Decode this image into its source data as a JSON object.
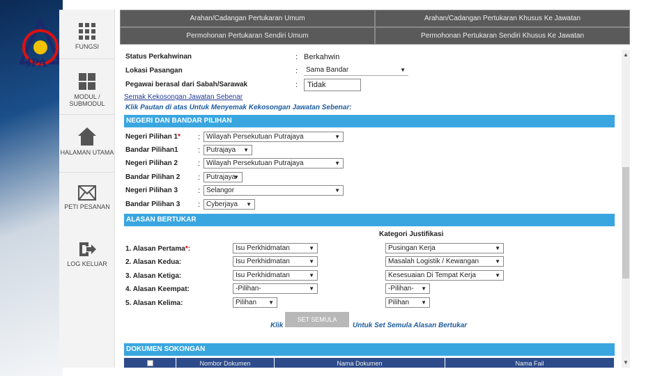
{
  "logo": {
    "text": "JPA"
  },
  "sidebar": {
    "items": [
      {
        "label": "FUNGSI",
        "icon": "grid-icon"
      },
      {
        "label": "MODUL / SUBMODUL",
        "icon": "modules-icon"
      },
      {
        "label": "HALAMAN UTAMA",
        "icon": "home-icon"
      },
      {
        "label": "PETI PESANAN",
        "icon": "envelope-icon"
      },
      {
        "label": "LOG KELUAR",
        "icon": "logout-icon"
      }
    ]
  },
  "tabs": [
    "Arahan/Cadangan Pertukaran Umum",
    "Arahan/Cadangan Pertukaran Khusus Ke Jawatan",
    "Permohonan Pertukaran Sendiri Umum",
    "Permohonan Pertukaran Sendiri Khusus Ke Jawatan"
  ],
  "personal": {
    "status_label": "Status Perkahwinan",
    "status_value": "Berkahwin",
    "lokasi_label": "Lokasi Pasangan",
    "lokasi_value": "Sama Bandar",
    "sabah_label": "Pegawai berasal dari Sabah/Sarawak",
    "sabah_value": "Tidak",
    "colon": ":"
  },
  "semak_link": "Semak Kekosongan Jawatan Sebenar",
  "semak_note": "Klik Pautan di atas Untuk Menyemak Kekosongan Jawatan Sebenar:",
  "negeri": {
    "header": "NEGERI DAN BANDAR PILIHAN",
    "rows": [
      {
        "label": "Negeri Pilihan 1",
        "req": "*",
        "value": "Wilayah Persekutuan Putrajaya"
      },
      {
        "label": "Bandar Pilihan1",
        "req": "",
        "value": "Putrajaya"
      },
      {
        "label": "Negeri Pilihan 2",
        "req": "",
        "value": "Wilayah Persekutuan Putrajaya"
      },
      {
        "label": "Bandar Pilihan 2",
        "req": "",
        "value": "Putrajaya"
      },
      {
        "label": "Negeri Pilihan 3",
        "req": "",
        "value": "Selangor"
      },
      {
        "label": "Bandar Pilihan 3",
        "req": "",
        "value": "Cyberjaya"
      }
    ]
  },
  "alasan": {
    "header": "ALASAN BERTUKAR",
    "kategori_label": "Kategori Justifikasi",
    "rows": [
      {
        "label": "1. Alasan Pertama",
        "req": "*:",
        "alasan": "Isu Perkhidmatan",
        "kategori": "Pusingan Kerja"
      },
      {
        "label": "2. Alasan Kedua:",
        "req": "",
        "alasan": "Isu Perkhidmatan",
        "kategori": "Masalah Logistik / Kewangan"
      },
      {
        "label": "3. Alasan Ketiga:",
        "req": "",
        "alasan": "Isu Perkhidmatan",
        "kategori": "Kesesuaian Di Tempat Kerja"
      },
      {
        "label": "4. Alasan Keempat:",
        "req": "",
        "alasan": "-Pilihan-",
        "kategori": "-Pilihan-"
      },
      {
        "label": "5. Alasan Kelima:",
        "req": "",
        "alasan": "Pilihan",
        "kategori": "Pilihan"
      }
    ],
    "reset_prefix": "Klik",
    "reset_button": "SET SEMULA",
    "reset_suffix": "Untuk Set Semula Alasan Bertukar"
  },
  "dokumen": {
    "header": "DOKUMEN SOKONGAN",
    "columns": [
      "Nombor Dokumen",
      "Nama Dokumen",
      "Nama Fail"
    ]
  }
}
